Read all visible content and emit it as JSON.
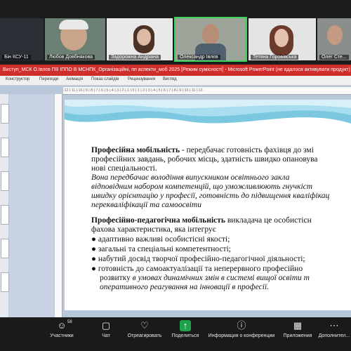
{
  "participants": [
    {
      "name": "Бін КСУ-11",
      "active": false
    },
    {
      "name": "Любов Довбнякова",
      "active": false
    },
    {
      "name": "Задорожна Андріана",
      "active": false
    },
    {
      "name": "Олександр Івлєв",
      "active": true
    },
    {
      "name": "Тетяна Горовівська",
      "active": false
    },
    {
      "name": "Олег Сте...",
      "active": false
    }
  ],
  "powerpoint": {
    "title": "Виступ_МСК О.Івлєв ПВ ІППО В МСНПК_Організаційні, пп аспекти_моб 2025 [Режим сумісності] - Microsoft PowerPoint (не вдалося активувати продукт)",
    "ribbon_tabs": [
      "Конструктор",
      "Переходи",
      "Анімація",
      "Показ слайдів",
      "Рецензування",
      "Вигляд"
    ],
    "ruler_text": "·12·|·11·|·10·|·9·|·8·|·7·|·6·|·5·|·4·|·3·|·2·|·1·|·0·|·1·|·2·|·3·|·4·|·5·|·6·|·7·|·8·|·9·|·10·|·11·|·12·"
  },
  "slide": {
    "p1_bold": "Професійна мобільність",
    "p1_rest": " -   передбачає готовність фахівця до змі",
    "p1_l2": "професійних завдань, робочих місць, здатність швидко опановува",
    "p1_l3": "нові спеціальності.",
    "p2_l1": "Вона   передбачає   володіння   випускником   освітнього   закла",
    "p2_l2": "відповідним  набором  компетенцій,  що  уможливлюють  гнучкіст",
    "p2_l3": "швидку орієнтацію у професії, готовність до підвищення кваліфікац",
    "p2_l4": "перекваліфікації та самоосвіти",
    "p3_bold": "Професійно-педагогічна  мобільність",
    "p3_rest": "  викладача  це  особистісн",
    "p3_l2": "фахова характеристика, яка інтегрує",
    "bullets": [
      "адаптивно важливі особистісні якості;",
      "загальні та спеціальні компетентності;",
      "набутий досвід творчої професійно-педагогічної діяльності;",
      "готовність  до  самоактуалізації  та  неперервного  професійно"
    ],
    "b4_l2a": "розвитку ",
    "b4_l2b": "в умовах динамічних змін в системі вищої освіти т",
    "b4_l3": "оперативного реагування на інновації в професії."
  },
  "toolbar": {
    "participants_count": "58",
    "items": [
      {
        "label": "Участники",
        "icon": "participants-icon"
      },
      {
        "label": "Чат",
        "icon": "chat-icon"
      },
      {
        "label": "Отреагировать",
        "icon": "react-icon"
      },
      {
        "label": "Поделиться",
        "icon": "share-icon"
      },
      {
        "label": "Информация о конференции",
        "icon": "info-icon"
      },
      {
        "label": "Приложения",
        "icon": "apps-icon"
      },
      {
        "label": "Дополнител...",
        "icon": "more-icon"
      }
    ]
  },
  "colors": {
    "title_bar": "#d02d2d",
    "active_speaker": "#3ed35a",
    "share": "#1fa34a"
  }
}
